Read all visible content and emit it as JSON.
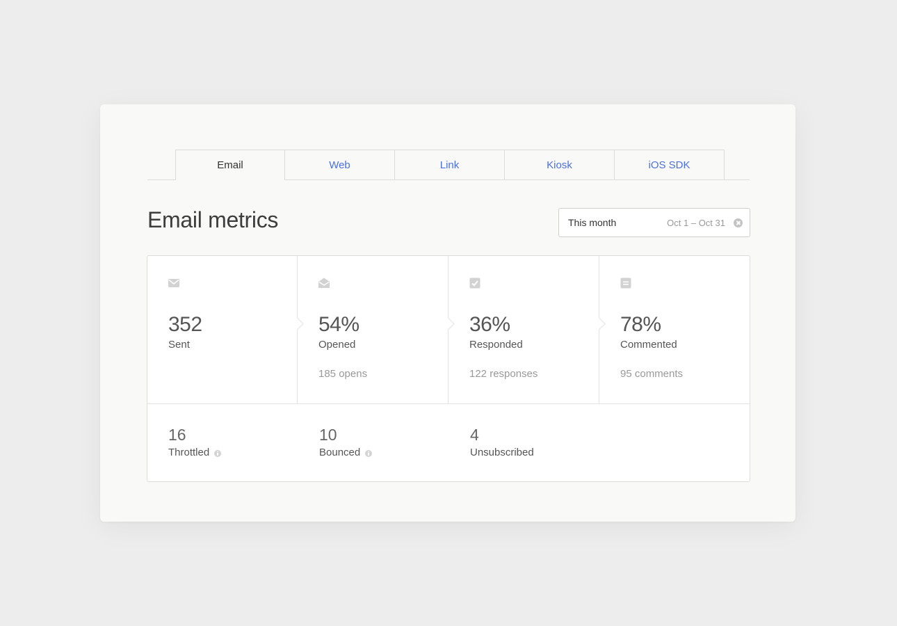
{
  "tabs": [
    {
      "label": "Email",
      "active": true
    },
    {
      "label": "Web",
      "active": false
    },
    {
      "label": "Link",
      "active": false
    },
    {
      "label": "Kiosk",
      "active": false
    },
    {
      "label": "iOS SDK",
      "active": false
    }
  ],
  "header": {
    "title": "Email metrics"
  },
  "date_filter": {
    "label": "This month",
    "range": "Oct 1 – Oct 31",
    "clear_icon": "clear-circle-icon"
  },
  "funnel": [
    {
      "icon": "envelope-icon",
      "value": "352",
      "label": "Sent",
      "detail": ""
    },
    {
      "icon": "envelope-open-icon",
      "value": "54%",
      "label": "Opened",
      "detail": "185 opens"
    },
    {
      "icon": "checkbox-icon",
      "value": "36%",
      "label": "Responded",
      "detail": "122 responses"
    },
    {
      "icon": "comment-icon",
      "value": "78%",
      "label": "Commented",
      "detail": "95 comments"
    }
  ],
  "secondary": [
    {
      "value": "16",
      "label": "Throttled",
      "has_info": true
    },
    {
      "value": "10",
      "label": "Bounced",
      "has_info": true
    },
    {
      "value": "4",
      "label": "Unsubscribed",
      "has_info": false
    }
  ],
  "colors": {
    "accent": "#4a6fe3",
    "background": "#ededed",
    "card": "#f9f9f8",
    "border": "#dcdcdc",
    "icon": "#d2d2d2"
  }
}
